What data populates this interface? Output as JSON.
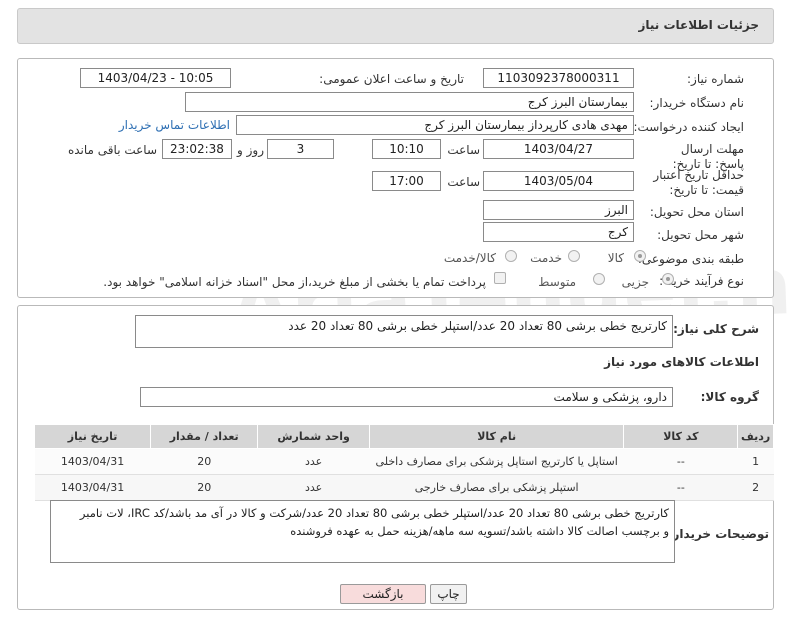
{
  "header": {
    "title": "جزئیات اطلاعات نیاز"
  },
  "form": {
    "need_number_label": "شماره نیاز:",
    "need_number": "1103092378000311",
    "announce_label": "تاریخ و ساعت اعلان عمومی:",
    "announce_value": "1403/04/23 - 10:05",
    "buyer_label": "نام دستگاه خریدار:",
    "buyer_value": "بیمارستان البرز کرج",
    "creator_label": "ایجاد کننده درخواست:",
    "creator_value": "مهدی هادی کارپرداز بیمارستان البرز کرج",
    "contact_link": "اطلاعات تماس خریدار",
    "deadline_label": "مهلت ارسال پاسخ: تا تاریخ:",
    "deadline_date": "1403/04/27",
    "time_label": "ساعت",
    "deadline_time": "10:10",
    "days_value": "3",
    "days_label": "روز و",
    "remaining_time": "23:02:38",
    "remaining_label": "ساعت باقی مانده",
    "min_validity_label": "حداقل تاریخ اعتبار قیمت: تا تاریخ:",
    "validity_date": "1403/05/04",
    "validity_time_label": "ساعت",
    "validity_time": "17:00",
    "province_label": "استان محل تحویل:",
    "province_value": "البرز",
    "city_label": "شهر محل تحویل:",
    "city_value": "کرج",
    "category_label": "طبقه بندی موضوعی:",
    "category_options": [
      "کالا",
      "خدمت",
      "کالا/خدمت"
    ],
    "purchase_label": "نوع فرآیند خرید :",
    "purchase_options": [
      "جزیی",
      "متوسط"
    ],
    "payment_note": "پرداخت تمام یا بخشی از مبلغ خرید،از محل \"اسناد خزانه اسلامی\" خواهد بود."
  },
  "description": {
    "label": "شرح کلی نیاز:",
    "value": "کارتریج خطی برشی 80 تعداد 20 عدد/استپلر خطی برشی 80 تعداد 20 عدد"
  },
  "goods": {
    "section_title": "اطلاعات کالاهای مورد نیاز",
    "group_label": "گروه کالا:",
    "group_value": "دارو، پزشکی و سلامت",
    "columns": [
      "ردیف",
      "کد کالا",
      "نام کالا",
      "واحد شمارش",
      "تعداد / مقدار",
      "تاریخ نیاز"
    ],
    "rows": [
      [
        "1",
        "--",
        "استاپل یا کارتریج استاپل پزشکی برای مصارف داخلی",
        "عدد",
        "20",
        "1403/04/31"
      ],
      [
        "2",
        "--",
        "استپلر پزشکی برای مصارف خارجی",
        "عدد",
        "20",
        "1403/04/31"
      ]
    ]
  },
  "buyer_notes": {
    "label": "توضیحات خریدار:",
    "line1": "کارتریج خطی برشی 80 تعداد 20 عدد/استپلر خطی برشی 80 تعداد 20 عدد/شرکت و کالا در آی مد باشد/کد IRC، لات نامبر",
    "line2": "و برچسب اصالت کالا داشته باشد/تسویه سه ماهه/هزینه حمل به عهده فروشنده"
  },
  "buttons": {
    "print": "چاپ",
    "back": "بازگشت"
  },
  "watermark": "AriaTender.neT"
}
